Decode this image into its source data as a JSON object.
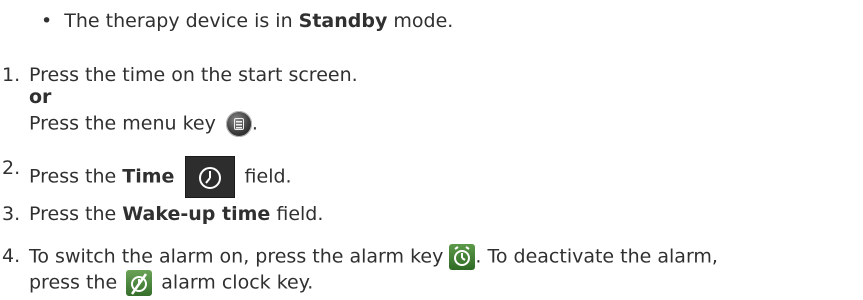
{
  "prerequisite": {
    "bullet": "•",
    "text_before": "The therapy device is in",
    "bold": "Standby",
    "text_after": "mode."
  },
  "steps": [
    {
      "number": "1.",
      "line1": "Press the time on the start screen.",
      "or": "or",
      "line3_before": "Press the menu key",
      "line3_after": ".",
      "icon": "menu-key-icon"
    },
    {
      "number": "2.",
      "before": "Press the",
      "bold": "Time",
      "after": "field.",
      "icon": "clock-icon"
    },
    {
      "number": "3.",
      "before": "Press the",
      "bold": "Wake-up time",
      "after": "field."
    },
    {
      "number": "4.",
      "line1_before": "To switch the alarm on, press the alarm key",
      "line1_after": ". To deactivate the alarm,",
      "line2_before": "press the",
      "line2_after": "alarm clock key.",
      "icon_on": "alarm-clock-icon",
      "icon_off": "alarm-clock-off-icon"
    }
  ]
}
